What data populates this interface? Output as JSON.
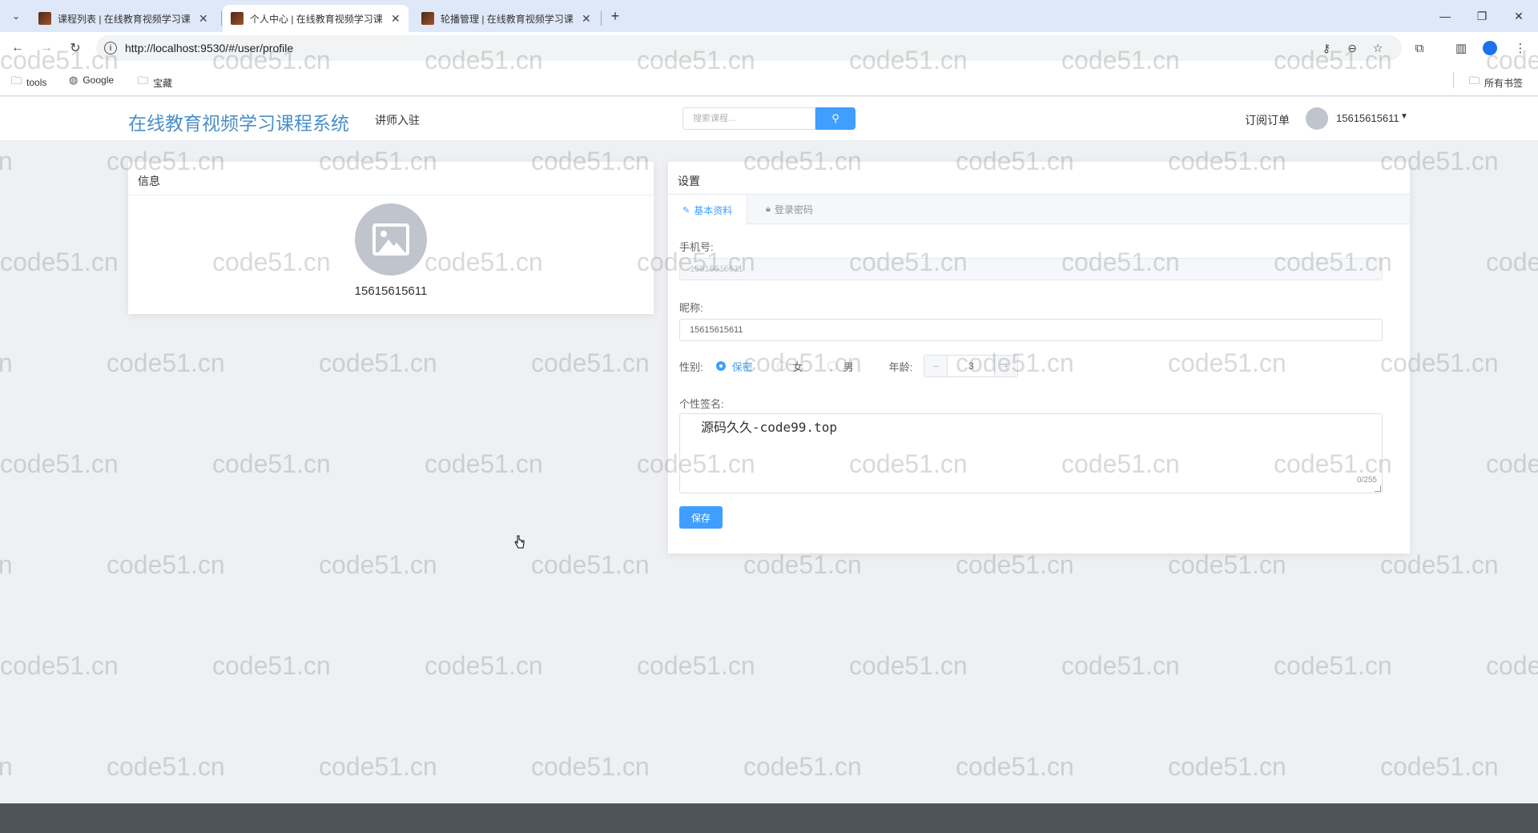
{
  "browser": {
    "tabs": [
      {
        "title": "课程列表 | 在线教育视频学习课",
        "active": false
      },
      {
        "title": "个人中心 | 在线教育视频学习课",
        "active": true
      },
      {
        "title": "轮播管理 | 在线教育视频学习课",
        "active": false
      }
    ],
    "url": "http://localhost:9530/#/user/profile",
    "bookmarks": [
      "tools",
      "Google",
      "宝藏"
    ],
    "all_bookmarks": "所有书签"
  },
  "header": {
    "logo": "在线教育视频学习课程系统",
    "nav_link": "讲师入驻",
    "search_placeholder": "搜索课程...",
    "orders": "订阅订单",
    "username": "15615615611"
  },
  "info_card": {
    "title": "信息",
    "name": "15615615611"
  },
  "settings": {
    "title": "设置",
    "tabs": [
      "基本资料",
      "登录密码"
    ],
    "phone_label": "手机号:",
    "phone_value": "15615615611",
    "nickname_label": "昵称:",
    "nickname_value": "15615615611",
    "gender_label": "性别:",
    "gender_options": [
      "保密",
      "女",
      "男"
    ],
    "gender_selected": "保密",
    "age_label": "年龄:",
    "age_value": "3",
    "signature_label": "个性签名:",
    "signature_value": "源码久久-code99.top",
    "signature_count": "0/255",
    "save_label": "保存"
  },
  "watermark": "code51.cn",
  "colors": {
    "accent": "#409eff",
    "logo": "#4a8fc7",
    "footer": "#4f5459"
  }
}
